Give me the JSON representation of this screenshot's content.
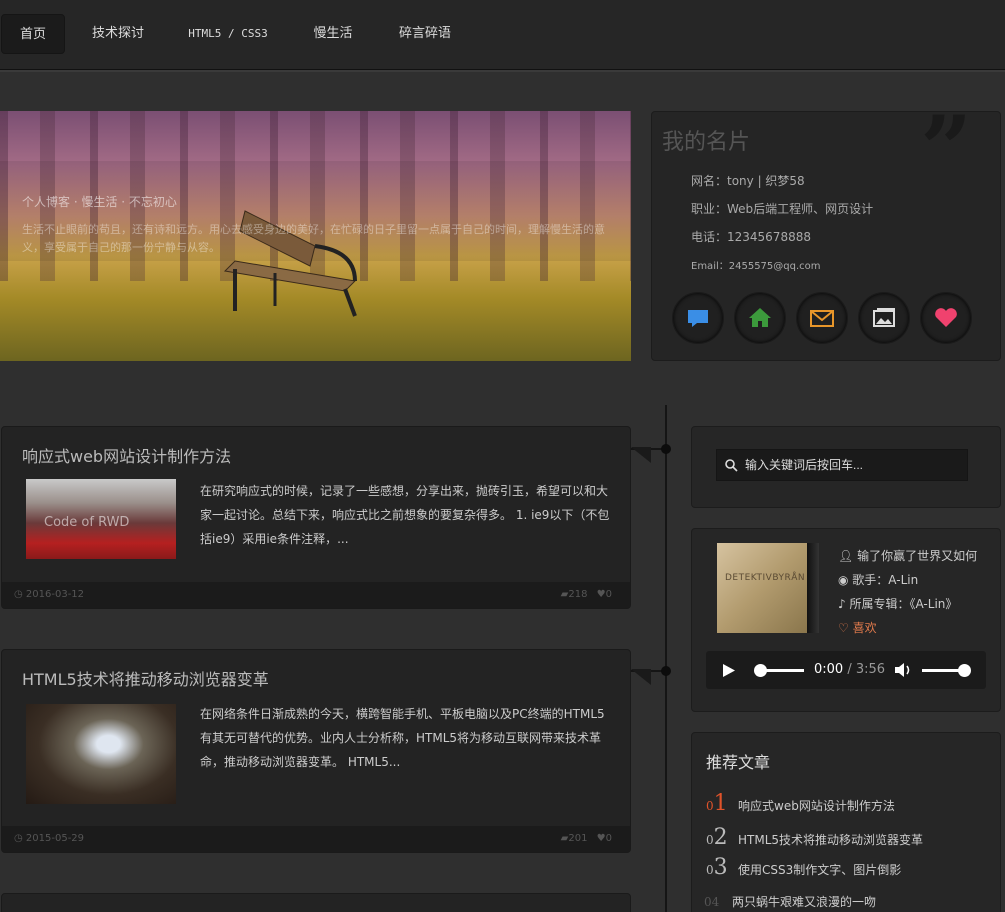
{
  "nav": {
    "items": [
      {
        "label": "首页"
      },
      {
        "label": "技术探讨"
      },
      {
        "label": "HTML5 / CSS3"
      },
      {
        "label": "慢生活"
      },
      {
        "label": "碎言碎语"
      }
    ]
  },
  "banner": {
    "title": "个人博客 · 慢生活 · 不忘初心",
    "text": "生活不止眼前的苟且，还有诗和远方。用心去感受身边的美好，在忙碌的日子里留一点属于自己的时间，理解慢生活的意义，享受属于自己的那一份宁静与从容。"
  },
  "card": {
    "title": "我的名片",
    "nickname": "网名：tony | 织梦58",
    "job": "职业：Web后端工程师、网页设计",
    "phone": "电话：12345678888",
    "email": "Email：2455575@qq.com"
  },
  "posts": [
    {
      "title": "响应式web网站设计制作方法",
      "image_caption": "Code of RWD",
      "text": "在研究响应式的时候，记录了一些感想，分享出来，抛砖引玉，希望可以和大家一起讨论。总结下来，响应式比之前想象的要复杂得多。 1. ie9以下（不包括ie9）采用ie条件注释，...",
      "date": "2016-03-12",
      "comments": "218",
      "likes": "0"
    },
    {
      "title": "HTML5技术将推动移动浏览器变革",
      "text": "在网络条件日渐成熟的今天，横跨智能手机、平板电脑以及PC终端的HTML5有其无可替代的优势。业内人士分析称，HTML5将为移动互联网带来技术革命，推动移动浏览器变革。 HTML5...",
      "date": "2015-05-29",
      "comments": "201",
      "likes": "0"
    }
  ],
  "search": {
    "placeholder": "输入关键词后按回车..."
  },
  "music": {
    "album_text": "DETEKTIVBYRÅN",
    "song": "输了你赢了世界又如何",
    "singer": "歌手：A-Lin",
    "album": "所属专辑：《A-Lin》",
    "like": "喜欢",
    "time_current": "0:00",
    "time_sep": "/",
    "time_total": "3:56",
    "progress": 0.0,
    "volume": 0.85
  },
  "recommend": {
    "title": "推荐文章",
    "items": [
      {
        "num_prefix": "0",
        "num": "1",
        "label": "响应式web网站设计制作方法",
        "color": "#e0532a"
      },
      {
        "num_prefix": "0",
        "num": "2",
        "label": "HTML5技术将推动移动浏览器变革",
        "color": "#bbbbbb"
      },
      {
        "num_prefix": "0",
        "num": "3",
        "label": "使用CSS3制作文字、图片倒影",
        "color": "#bbbbbb"
      },
      {
        "num_prefix": "",
        "num": "04",
        "label": "两只蜗牛艰难又浪漫的一吻",
        "color": "#555555"
      }
    ]
  },
  "icons": [
    "comment-icon",
    "home-icon",
    "mail-icon",
    "image-icon",
    "heart-icon",
    "search-icon",
    "user-icon",
    "disc-icon",
    "music-note-icon",
    "clock-icon",
    "play-icon",
    "volume-icon"
  ]
}
